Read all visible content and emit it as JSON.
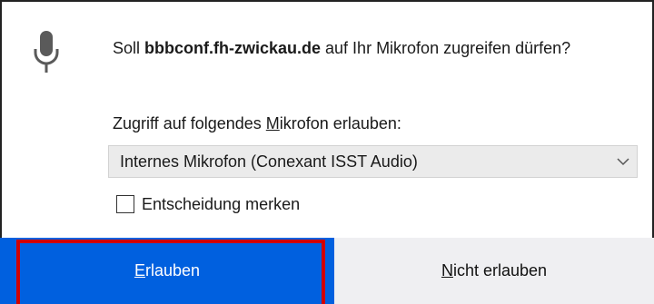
{
  "dialog": {
    "prompt_prefix": "Soll ",
    "prompt_host": "bbbconf.fh-zwickau.de",
    "prompt_suffix": " auf Ihr Mikrofon zugreifen dürfen?",
    "mic_label_before": "Zugriff auf folgendes ",
    "mic_label_accesskey": "M",
    "mic_label_after": "ikrofon erlauben:",
    "mic_select_value": "Internes Mikrofon (Conexant ISST Audio)",
    "remember_label": "Entscheidung merken",
    "remember_checked": false,
    "allow_accesskey": "E",
    "allow_rest": "rlauben",
    "deny_accesskey": "N",
    "deny_rest": "icht erlauben"
  },
  "icons": {
    "prompt_icon": "microphone-icon",
    "select_icon": "chevron-down-icon"
  },
  "colors": {
    "allow_button": "#0060df",
    "deny_button": "#efeff2",
    "highlight_box": "#d00000"
  }
}
